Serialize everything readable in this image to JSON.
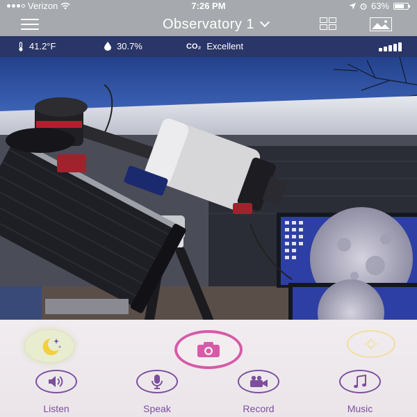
{
  "status_bar": {
    "carrier": "Verizon",
    "time": "7:26 PM",
    "battery": "63%",
    "battery_level": 0.63
  },
  "header": {
    "title": "Observatory 1"
  },
  "sensors": {
    "temperature": "41.2°F",
    "humidity": "30.7%",
    "co2_label": "CO₂",
    "co2_status": "Excellent"
  },
  "actions": [
    {
      "label": "Listen",
      "icon": "speaker-icon"
    },
    {
      "label": "Speak",
      "icon": "microphone-icon"
    },
    {
      "label": "Record",
      "icon": "video-camera-icon"
    },
    {
      "label": "Music",
      "icon": "music-note-icon"
    }
  ],
  "colors": {
    "accent_purple": "#7c4f9e",
    "snapshot_pink": "#d75aa8",
    "sensor_bar": "#2a3568",
    "header_gray": "#a6a9ad",
    "night_mode_yellow": "#f3cf3c"
  }
}
